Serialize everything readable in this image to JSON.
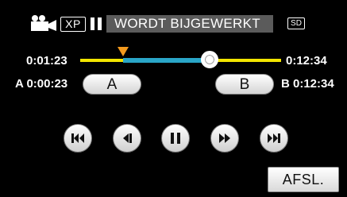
{
  "header": {
    "camera_icon": "video-camera-icon",
    "quality": "XP",
    "status_icon": "pause-icon",
    "status_text": "WORDT BIJGEWERKT",
    "media": "SD"
  },
  "timeline": {
    "current_time": "0:01:23",
    "total_time": "0:12:34",
    "marker_icon": "playhead-marker-icon",
    "knob_icon": "slider-knob-icon",
    "track_color": "#f2e500",
    "selection_color": "#2aa6c8"
  },
  "ab": {
    "a_label": "A 0:00:23",
    "a_button": "A",
    "b_label": "B 0:12:34",
    "b_button": "B"
  },
  "controls": [
    {
      "name": "skip-previous",
      "icon": "skip-previous-icon"
    },
    {
      "name": "frame-back",
      "icon": "frame-back-icon"
    },
    {
      "name": "pause",
      "icon": "pause-icon"
    },
    {
      "name": "fast-forward",
      "icon": "fast-forward-icon"
    },
    {
      "name": "skip-next",
      "icon": "skip-next-icon"
    }
  ],
  "footer": {
    "exit_button": "AFSL."
  }
}
